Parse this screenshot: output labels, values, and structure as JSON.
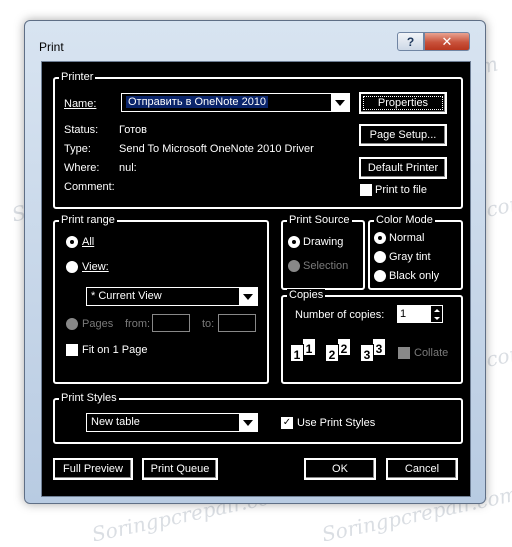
{
  "window": {
    "title": "Print"
  },
  "titlebar": {
    "help_glyph": "?",
    "close_glyph": "✕"
  },
  "printer": {
    "group_title": "Printer",
    "name_label": "Name:",
    "name_value": "Отправить в OneNote 2010",
    "status_label": "Status:",
    "status_value": "Готов",
    "type_label": "Type:",
    "type_value": "Send To Microsoft OneNote 2010 Driver",
    "where_label": "Where:",
    "where_value": "nul:",
    "comment_label": "Comment:",
    "properties_label": "Properties",
    "page_setup_label": "Page Setup...",
    "default_printer_label": "Default Printer",
    "print_to_file_label": "Print to file"
  },
  "print_range": {
    "group_title": "Print range",
    "all_label": "All",
    "view_label": "View:",
    "view_value": "* Current View",
    "pages_label": "Pages",
    "from_label": "from:",
    "to_label": "to:",
    "fit_label": "Fit on 1 Page"
  },
  "print_source": {
    "group_title": "Print Source",
    "drawing_label": "Drawing",
    "selection_label": "Selection"
  },
  "color_mode": {
    "group_title": "Color Mode",
    "normal_label": "Normal",
    "gray_label": "Gray tint",
    "black_label": "Black only"
  },
  "copies": {
    "group_title": "Copies",
    "number_label": "Number of copies:",
    "number_value": "1",
    "collate_label": "Collate",
    "page_numbers": [
      "1",
      "1",
      "2",
      "2",
      "3",
      "3"
    ]
  },
  "print_styles": {
    "group_title": "Print Styles",
    "style_value": "New table",
    "use_styles_label": "Use Print Styles"
  },
  "buttons": {
    "full_preview": "Full Preview",
    "print_queue": "Print Queue",
    "ok": "OK",
    "cancel": "Cancel"
  },
  "watermark": "Soringpcrepair.com"
}
